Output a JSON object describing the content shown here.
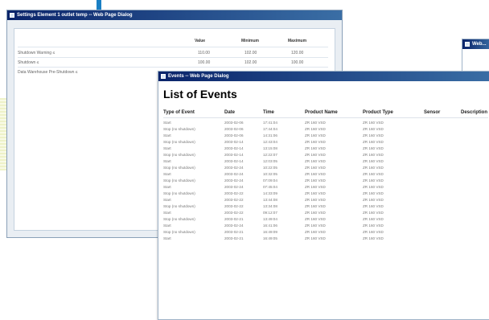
{
  "settings_dialog": {
    "title": "Settings Element 1 outlet temp -- Web Page Dialog",
    "columns": [
      "Value",
      "Minimum",
      "Maximum"
    ],
    "rows": [
      {
        "label": "Shutdown Warning ≤",
        "value": "110.00",
        "min": "102.00",
        "max": "120.00"
      },
      {
        "label": "Shutdown ≤",
        "value": "100.00",
        "min": "102.00",
        "max": "100.00"
      },
      {
        "label": "Data Warehouse Pre-Shutdown ≤",
        "value": "",
        "min": "",
        "max": ""
      }
    ]
  },
  "right_dialog": {
    "title": "Web..."
  },
  "events_dialog": {
    "title": "Events -- Web Page Dialog",
    "heading": "List of Events",
    "columns": [
      "Type of Event",
      "Date",
      "Time",
      "Product Name",
      "Product Type",
      "Sensor",
      "Description"
    ],
    "rows": [
      {
        "type": "Start",
        "date": "2003-02-06",
        "time": "17:41:04",
        "product": "ZR 160 VSD",
        "ptype": "ZR 160 VSD"
      },
      {
        "type": "Stop (no shutdown)",
        "date": "2003-02-06",
        "time": "17:44:04",
        "product": "ZR 160 VSD",
        "ptype": "ZR 160 VSD"
      },
      {
        "type": "Start",
        "date": "2003-02-06",
        "time": "14:31:06",
        "product": "ZR 160 VSD",
        "ptype": "ZR 160 VSD"
      },
      {
        "type": "Stop (no shutdown)",
        "date": "2003-02-14",
        "time": "12:43:04",
        "product": "ZR 160 VSD",
        "ptype": "ZR 160 VSD"
      },
      {
        "type": "Start",
        "date": "2003-02-14",
        "time": "13:15:08",
        "product": "ZR 160 VSD",
        "ptype": "ZR 160 VSD"
      },
      {
        "type": "Stop (no shutdown)",
        "date": "2003-02-14",
        "time": "12:22:07",
        "product": "ZR 160 VSD",
        "ptype": "ZR 160 VSD"
      },
      {
        "type": "Start",
        "date": "2003-02-14",
        "time": "12:03:05",
        "product": "ZR 160 VSD",
        "ptype": "ZR 160 VSD"
      },
      {
        "type": "Stop (no shutdown)",
        "date": "2003-02-24",
        "time": "10:22:05",
        "product": "ZR 160 VSD",
        "ptype": "ZR 160 VSD"
      },
      {
        "type": "Start",
        "date": "2003-02-24",
        "time": "10:32:05",
        "product": "ZR 160 VSD",
        "ptype": "ZR 160 VSD"
      },
      {
        "type": "Stop (no shutdown)",
        "date": "2003-02-24",
        "time": "07:09:04",
        "product": "ZR 160 VSD",
        "ptype": "ZR 160 VSD"
      },
      {
        "type": "Start",
        "date": "2003-02-24",
        "time": "07:45:04",
        "product": "ZR 160 VSD",
        "ptype": "ZR 160 VSD"
      },
      {
        "type": "Stop (no shutdown)",
        "date": "2003-02-22",
        "time": "14:33:09",
        "product": "ZR 160 VSD",
        "ptype": "ZR 160 VSD"
      },
      {
        "type": "Start",
        "date": "2003-02-22",
        "time": "13:44:08",
        "product": "ZR 160 VSD",
        "ptype": "ZR 160 VSD"
      },
      {
        "type": "Stop (no shutdown)",
        "date": "2003-02-22",
        "time": "13:34:08",
        "product": "ZR 160 VSD",
        "ptype": "ZR 160 VSD"
      },
      {
        "type": "Start",
        "date": "2003-02-22",
        "time": "09:12:07",
        "product": "ZR 160 VSD",
        "ptype": "ZR 160 VSD"
      },
      {
        "type": "Stop (no shutdown)",
        "date": "2003-02-21",
        "time": "13:49:04",
        "product": "ZR 160 VSD",
        "ptype": "ZR 160 VSD"
      },
      {
        "type": "Start",
        "date": "2003-02-24",
        "time": "16:41:06",
        "product": "ZR 160 VSD",
        "ptype": "ZR 160 VSD"
      },
      {
        "type": "Stop (no shutdown)",
        "date": "2003-02-21",
        "time": "16:49:09",
        "product": "ZR 160 VSD",
        "ptype": "ZR 160 VSD"
      },
      {
        "type": "Start",
        "date": "2003-02-21",
        "time": "16:49:05",
        "product": "ZR 160 VSD",
        "ptype": "ZR 160 VSD"
      }
    ]
  },
  "colors": {
    "titlebar": "#0a246a",
    "accent": "#1a7fc4"
  }
}
